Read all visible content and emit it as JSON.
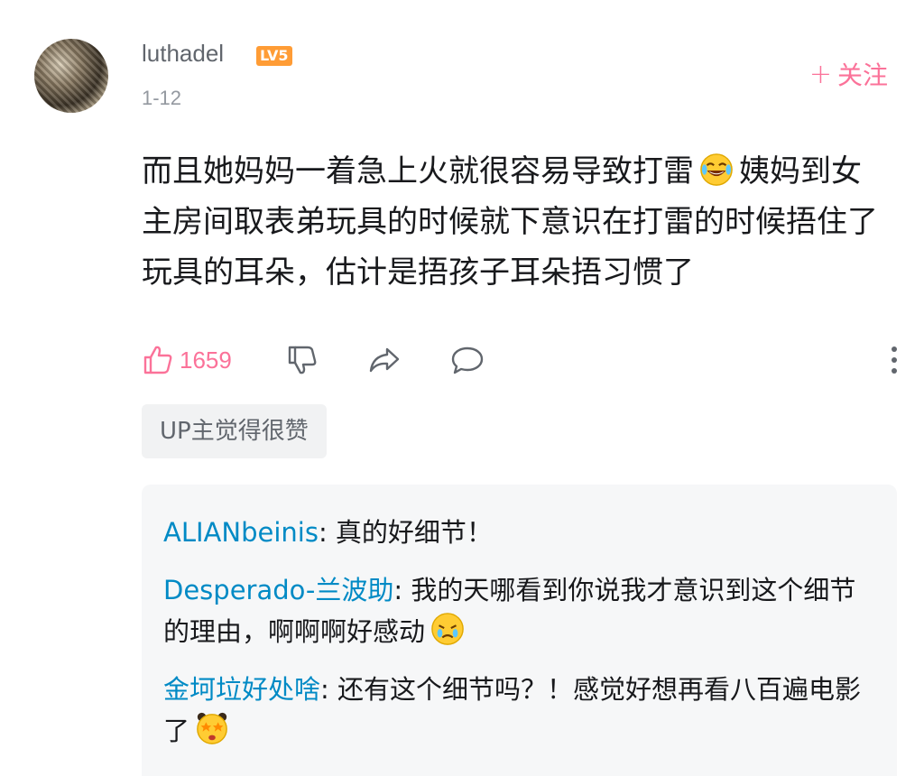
{
  "comment": {
    "username": "luthadel",
    "level": "LV5",
    "date": "1-12",
    "follow_label": "关注",
    "text_part1": "而且她妈妈一着急上火就很容易导致打雷",
    "text_part2": "姨妈到女主房间取表弟玩具的时候就下意识在打雷的时候捂住了玩具的耳朵，估计是捂孩子耳朵捂习惯了",
    "emoji_1": "laugh-cry-emoji",
    "like_count": "1659",
    "up_tag": "UP主觉得很赞"
  },
  "replies": [
    {
      "user": "ALIANbeinis",
      "text": ": 真的好细节！"
    },
    {
      "user": "Desperado-兰波助",
      "text": ": 我的天哪看到你说我才意识到这个细节的理由，啊啊啊好感动",
      "emoji": "touched-cry-emoji"
    },
    {
      "user": "金坷垃好处啥",
      "text": ": 还有这个细节吗？！感觉好想再看八百遍电影了",
      "emoji": "starry-eyed-emoji"
    }
  ],
  "colors": {
    "accent_pink": "#fb7299",
    "link_blue": "#008ac5",
    "level_orange": "#ff9c35",
    "reply_bg": "#f6f7f8"
  }
}
